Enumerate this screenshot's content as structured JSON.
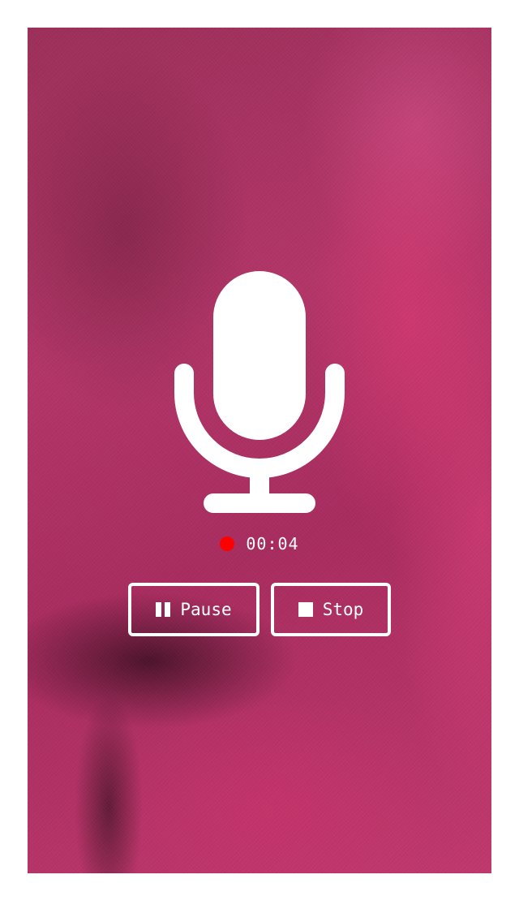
{
  "recorder": {
    "icon": "microphone-icon",
    "recording_indicator_color": "#ff0000",
    "elapsed_time": "00:04"
  },
  "controls": {
    "pause_label": "Pause",
    "stop_label": "Stop"
  },
  "colors": {
    "background_tint": "#b23568",
    "foreground": "#ffffff",
    "recording_dot": "#ff0000"
  }
}
